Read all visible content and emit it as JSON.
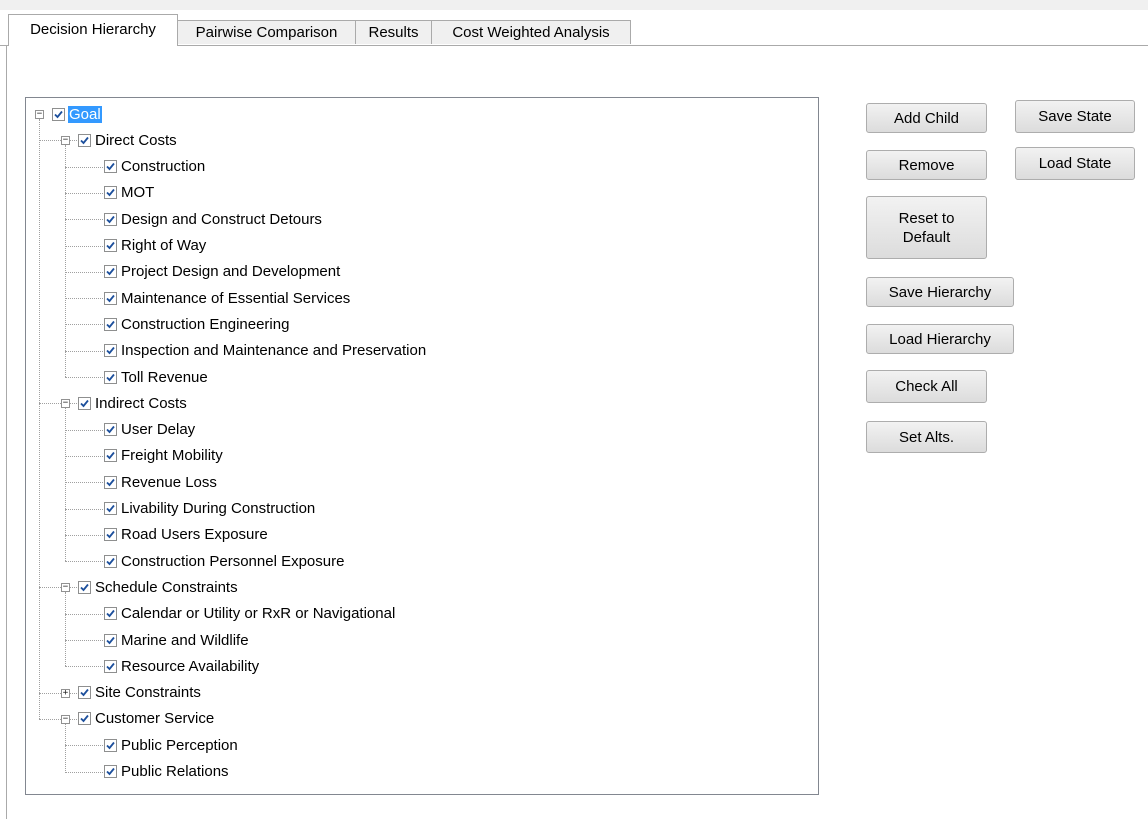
{
  "tabs": [
    {
      "label": "Decision Hierarchy",
      "active": true
    },
    {
      "label": "Pairwise Comparison",
      "active": false
    },
    {
      "label": "Results",
      "active": false
    },
    {
      "label": "Cost Weighted Analysis",
      "active": false
    }
  ],
  "tree": {
    "label": "Goal",
    "checked": true,
    "selected": true,
    "expanded": true,
    "children": [
      {
        "label": "Direct Costs",
        "checked": true,
        "expanded": true,
        "children": [
          {
            "label": "Construction",
            "checked": true
          },
          {
            "label": "MOT",
            "checked": true
          },
          {
            "label": "Design and Construct Detours",
            "checked": true
          },
          {
            "label": "Right of Way",
            "checked": true
          },
          {
            "label": "Project Design and Development",
            "checked": true
          },
          {
            "label": "Maintenance of Essential Services",
            "checked": true
          },
          {
            "label": "Construction Engineering",
            "checked": true
          },
          {
            "label": "Inspection and Maintenance and Preservation",
            "checked": true
          },
          {
            "label": "Toll Revenue",
            "checked": true
          }
        ]
      },
      {
        "label": "Indirect Costs",
        "checked": true,
        "expanded": true,
        "children": [
          {
            "label": "User Delay",
            "checked": true
          },
          {
            "label": "Freight Mobility",
            "checked": true
          },
          {
            "label": "Revenue Loss",
            "checked": true
          },
          {
            "label": "Livability During Construction",
            "checked": true
          },
          {
            "label": "Road Users Exposure",
            "checked": true
          },
          {
            "label": "Construction Personnel Exposure",
            "checked": true
          }
        ]
      },
      {
        "label": "Schedule Constraints",
        "checked": true,
        "expanded": true,
        "children": [
          {
            "label": "Calendar or Utility or RxR or Navigational",
            "checked": true
          },
          {
            "label": "Marine and Wildlife",
            "checked": true
          },
          {
            "label": "Resource Availability",
            "checked": true
          }
        ]
      },
      {
        "label": "Site Constraints",
        "checked": true,
        "expanded": false,
        "children": []
      },
      {
        "label": "Customer Service",
        "checked": true,
        "expanded": true,
        "children": [
          {
            "label": "Public Perception",
            "checked": true
          },
          {
            "label": "Public Relations",
            "checked": true
          }
        ]
      }
    ]
  },
  "buttons": {
    "add_child": "Add Child",
    "remove": "Remove",
    "reset_line1": "Reset to",
    "reset_line2": "Default",
    "save_hierarchy": "Save Hierarchy",
    "load_hierarchy": "Load Hierarchy",
    "check_all": "Check All",
    "set_alts": "Set Alts.",
    "save_state": "Save State",
    "load_state": "Load State"
  },
  "colors": {
    "selection": "#3399ff",
    "check": "#1c4f9c"
  }
}
